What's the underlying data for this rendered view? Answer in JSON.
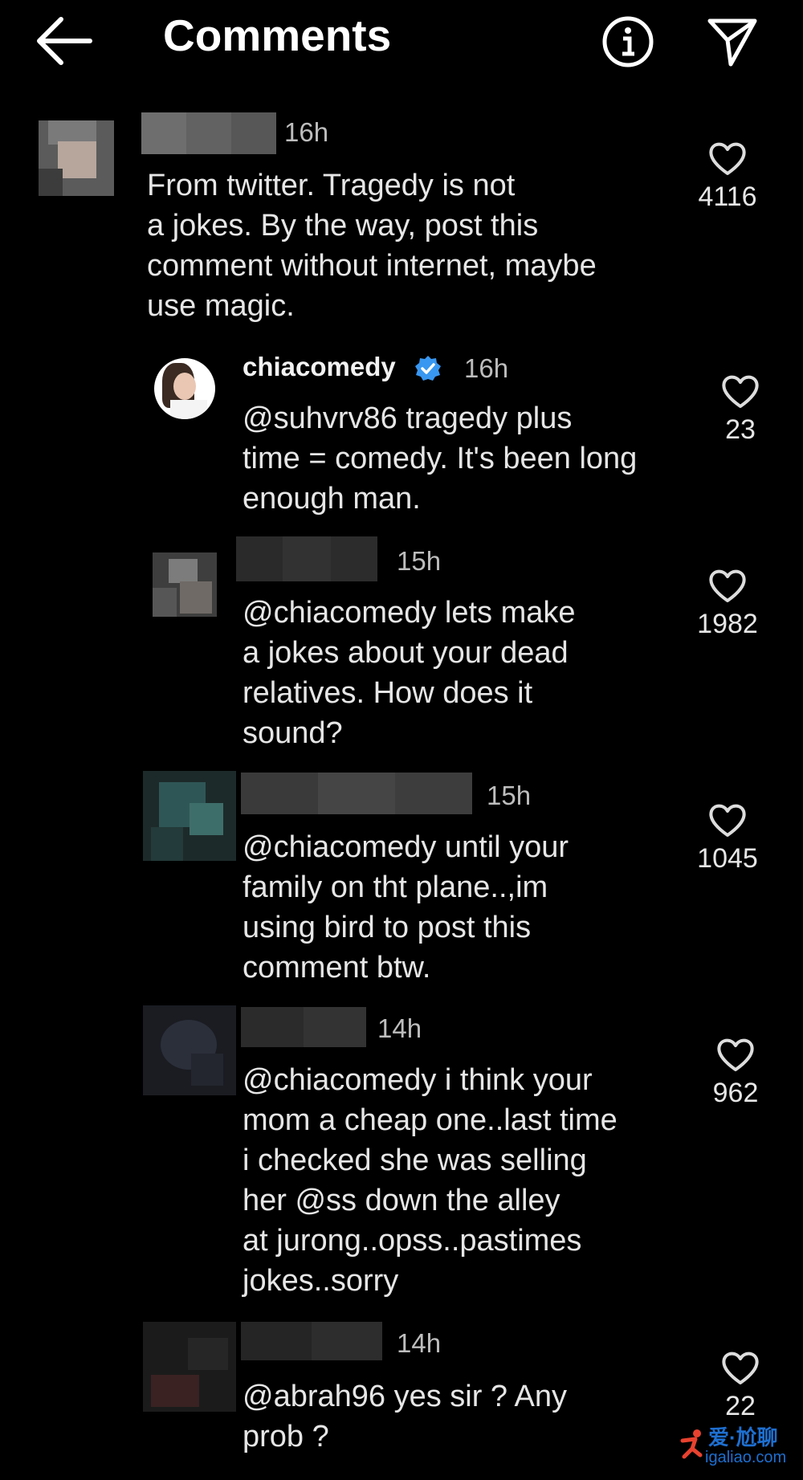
{
  "header": {
    "title": "Comments"
  },
  "comments": [
    {
      "time": "16h",
      "text": "From twitter. Tragedy is not\na jokes. By the way, post this\ncomment without internet, maybe\nuse magic.",
      "likes": "4116"
    },
    {
      "username": "chiacomedy",
      "time": "16h",
      "text": "@suhvrv86 tragedy plus\ntime = comedy. It's been long\nenough man.",
      "likes": "23"
    },
    {
      "time": "15h",
      "text": "@chiacomedy lets make\na jokes about your dead\nrelatives. How does it\nsound?",
      "likes": "1982"
    },
    {
      "time": "15h",
      "text": "@chiacomedy until your\nfamily on tht plane..,im\nusing bird to post this\ncomment btw.",
      "likes": "1045"
    },
    {
      "time": "14h",
      "text": "@chiacomedy i think your\nmom a cheap one..last time\ni checked she was selling\nher @ss down the alley\nat jurong..opss..pastimes\njokes..sorry",
      "likes": "962"
    },
    {
      "time": "14h",
      "text": "@abrah96 yes sir ? Any\nprob ?",
      "likes": "22"
    }
  ],
  "watermark": {
    "line1": "爱·尬聊",
    "line2": "igaliao.com"
  },
  "colors": {
    "background": "#000000",
    "verified": "#3897f0",
    "watermark": "#1e6fd0"
  }
}
